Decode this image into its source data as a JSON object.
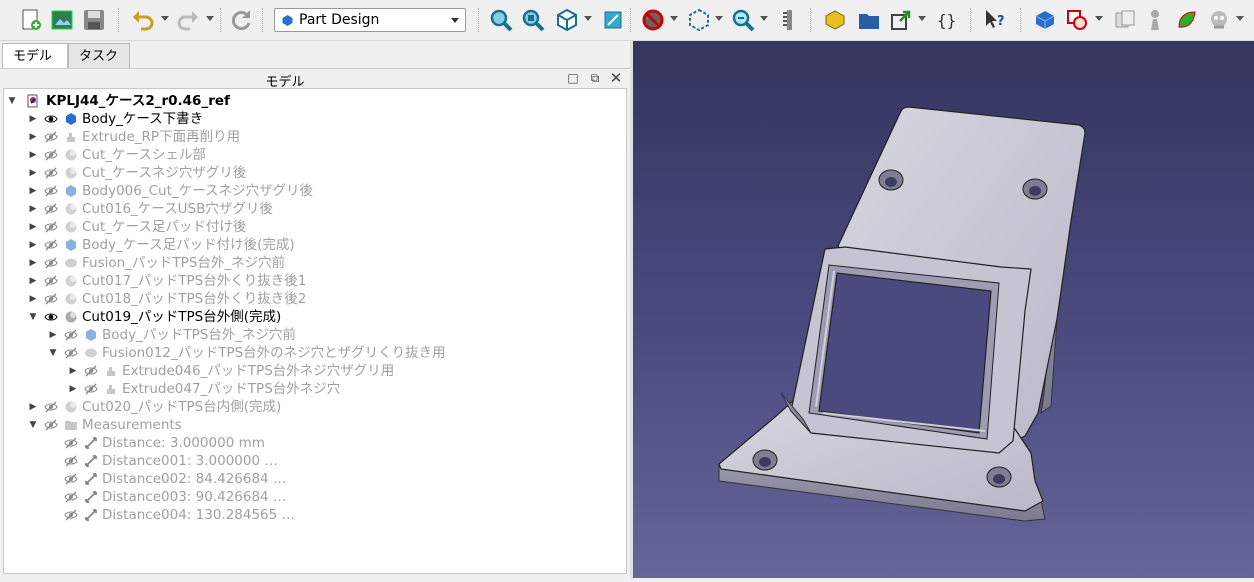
{
  "toolbar": {
    "workbench_label": "Part Design",
    "icons": [
      "new-document-icon",
      "open-document-icon",
      "save-icon",
      "undo-icon",
      "redo-icon",
      "refresh-icon",
      "fit-all-icon",
      "fit-selection-icon",
      "view-cube-icon",
      "sketch-view-icon",
      "draw-style-icon",
      "bounding-box-icon",
      "zoom-icon",
      "measure-icon",
      "part-icon",
      "folder-icon",
      "link-icon",
      "macro-icon",
      "whats-this-icon",
      "body-icon",
      "boolean-icon",
      "clone-icon",
      "pawn-icon",
      "leaf-icon",
      "robot-icon"
    ]
  },
  "tabs": [
    {
      "label": "モデル",
      "active": true
    },
    {
      "label": "タスク",
      "active": false
    }
  ],
  "panel": {
    "title": "モデル"
  },
  "tree": [
    {
      "label": "KPLJ44_ケース2_r0.46_ref",
      "level": 0,
      "expanded": true,
      "dim": false,
      "visible": null,
      "kind": "doc",
      "bold": true
    },
    {
      "label": "Body_ケース下書き",
      "level": 1,
      "expanded": false,
      "dim": false,
      "visible": true,
      "kind": "body"
    },
    {
      "label": "Extrude_RP下面再削り用",
      "level": 1,
      "expanded": false,
      "dim": true,
      "visible": false,
      "kind": "extrude"
    },
    {
      "label": "Cut_ケースシェル部",
      "level": 1,
      "expanded": false,
      "dim": true,
      "visible": false,
      "kind": "cut"
    },
    {
      "label": "Cut_ケースネジ穴ザグリ後",
      "level": 1,
      "expanded": false,
      "dim": true,
      "visible": false,
      "kind": "cut"
    },
    {
      "label": "Body006_Cut_ケースネジ穴ザグリ後",
      "level": 1,
      "expanded": false,
      "dim": true,
      "visible": false,
      "kind": "body"
    },
    {
      "label": "Cut016_ケースUSB穴ザグリ後",
      "level": 1,
      "expanded": false,
      "dim": true,
      "visible": false,
      "kind": "cut"
    },
    {
      "label": "Cut_ケース足パッド付け後",
      "level": 1,
      "expanded": false,
      "dim": true,
      "visible": false,
      "kind": "cut"
    },
    {
      "label": "Body_ケース足パッド付け後(完成)",
      "level": 1,
      "expanded": false,
      "dim": true,
      "visible": false,
      "kind": "body"
    },
    {
      "label": "Fusion_パッドTPS台外_ネジ穴前",
      "level": 1,
      "expanded": false,
      "dim": true,
      "visible": false,
      "kind": "fusion"
    },
    {
      "label": "Cut017_パッドTPS台外くり抜き後1",
      "level": 1,
      "expanded": false,
      "dim": true,
      "visible": false,
      "kind": "cut"
    },
    {
      "label": "Cut018_パッドTPS台外くり抜き後2",
      "level": 1,
      "expanded": false,
      "dim": true,
      "visible": false,
      "kind": "cut"
    },
    {
      "label": "Cut019_パッドTPS台外側(完成)",
      "level": 1,
      "expanded": true,
      "dim": false,
      "visible": true,
      "kind": "cut"
    },
    {
      "label": "Body_パッドTPS台外_ネジ穴前",
      "level": 2,
      "expanded": false,
      "dim": true,
      "visible": false,
      "kind": "body"
    },
    {
      "label": "Fusion012_パッドTPS台外のネジ穴とザグリくり抜き用",
      "level": 2,
      "expanded": true,
      "dim": true,
      "visible": false,
      "kind": "fusion"
    },
    {
      "label": "Extrude046_パッドTPS台外ネジ穴ザグリ用",
      "level": 3,
      "expanded": false,
      "dim": true,
      "visible": false,
      "kind": "extrude"
    },
    {
      "label": "Extrude047_パッドTPS台外ネジ穴",
      "level": 3,
      "expanded": false,
      "dim": true,
      "visible": false,
      "kind": "extrude"
    },
    {
      "label": "Cut020_パッドTPS台内側(完成)",
      "level": 1,
      "expanded": false,
      "dim": true,
      "visible": false,
      "kind": "cut"
    },
    {
      "label": "Measurements",
      "level": 1,
      "expanded": true,
      "dim": true,
      "visible": false,
      "kind": "group"
    },
    {
      "label": "Distance: 3.000000 mm",
      "level": 2,
      "expanded": null,
      "dim": true,
      "visible": false,
      "kind": "measure"
    },
    {
      "label": "Distance001: 3.000000 …",
      "level": 2,
      "expanded": null,
      "dim": true,
      "visible": false,
      "kind": "measure"
    },
    {
      "label": "Distance002: 84.426684 …",
      "level": 2,
      "expanded": null,
      "dim": true,
      "visible": false,
      "kind": "measure"
    },
    {
      "label": "Distance003: 90.426684 …",
      "level": 2,
      "expanded": null,
      "dim": true,
      "visible": false,
      "kind": "measure"
    },
    {
      "label": "Distance004: 130.284565 …",
      "level": 2,
      "expanded": null,
      "dim": true,
      "visible": false,
      "kind": "measure"
    }
  ],
  "colors": {
    "viewport_top": "#35355f",
    "viewport_bottom": "#65659a",
    "part": "#c9c9d6"
  }
}
